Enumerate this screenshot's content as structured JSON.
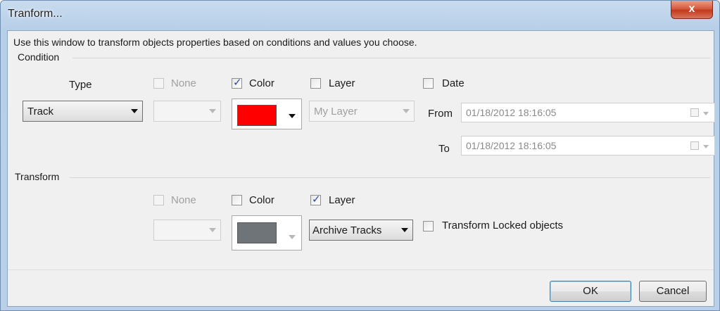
{
  "window": {
    "title": "Tranform...",
    "close_label": "x",
    "hint": "Use this window to transform objects properties based on conditions and values you choose."
  },
  "condition": {
    "group_label": "Condition",
    "type_label": "Type",
    "type_value": "Track",
    "none_label": "None",
    "none_checked": false,
    "none_enabled": false,
    "color_label": "Color",
    "color_checked": true,
    "color_value": "#ff0000",
    "layer_label": "Layer",
    "layer_checked": false,
    "layer_value": "My Layer",
    "date_label": "Date",
    "date_checked": false,
    "from_label": "From",
    "from_value": "01/18/2012 18:16:05",
    "to_label": "To",
    "to_value": "01/18/2012 18:16:05"
  },
  "transform": {
    "group_label": "Transform",
    "none_label": "None",
    "none_checked": false,
    "none_enabled": false,
    "color_label": "Color",
    "color_checked": false,
    "color_value": "#6e7478",
    "layer_label": "Layer",
    "layer_checked": true,
    "layer_value": "Archive Tracks",
    "locked_label": "Transform Locked objects",
    "locked_checked": false
  },
  "buttons": {
    "ok_label": "OK",
    "cancel_label": "Cancel"
  },
  "icons": {
    "checkmark": "check-icon",
    "dropdown": "chevron-down-icon",
    "calendar": "calendar-icon"
  }
}
